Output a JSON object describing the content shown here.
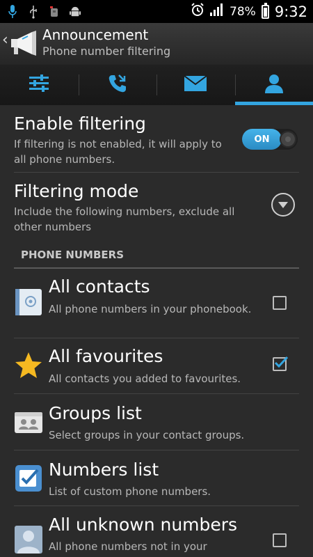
{
  "status_bar": {
    "battery_percent": "78%",
    "time": "9:32",
    "icons": [
      "microphone-icon",
      "usb-icon",
      "bug-icon",
      "android-icon",
      "alarm-icon",
      "signal-icon"
    ]
  },
  "action_bar": {
    "title": "Announcement",
    "subtitle": "Phone number filtering",
    "logo_icon": "megaphone-icon"
  },
  "tabs": [
    {
      "icon": "sliders-icon",
      "active": false
    },
    {
      "icon": "phone-call-icon",
      "active": false
    },
    {
      "icon": "envelope-icon",
      "active": false
    },
    {
      "icon": "person-icon",
      "active": true
    }
  ],
  "settings": {
    "enable_filtering": {
      "title": "Enable filtering",
      "description": "If filtering is not enabled, it will apply to all phone numbers.",
      "toggle_label": "ON",
      "enabled": true
    },
    "filtering_mode": {
      "title": "Filtering mode",
      "description": "Include the following numbers, exclude all other numbers"
    }
  },
  "phone_numbers": {
    "header": "PHONE NUMBERS",
    "items": [
      {
        "title": "All contacts",
        "description": "All phone numbers in your phonebook.",
        "checked": false,
        "icon": "contacts-book-icon"
      },
      {
        "title": "All favourites",
        "description": "All contacts you added to favourites.",
        "checked": true,
        "icon": "star-icon"
      },
      {
        "title": "Groups list",
        "description": "Select groups in your contact groups.",
        "icon": "groups-icon"
      },
      {
        "title": "Numbers list",
        "description": "List of custom phone numbers.",
        "icon": "checklist-icon"
      },
      {
        "title": "All unknown numbers",
        "description": "All phone numbers not in your",
        "checked": false,
        "icon": "unknown-person-icon"
      }
    ]
  },
  "colors": {
    "accent": "#33a5e0",
    "background": "#2b2b2b",
    "star": "#f5b921"
  }
}
